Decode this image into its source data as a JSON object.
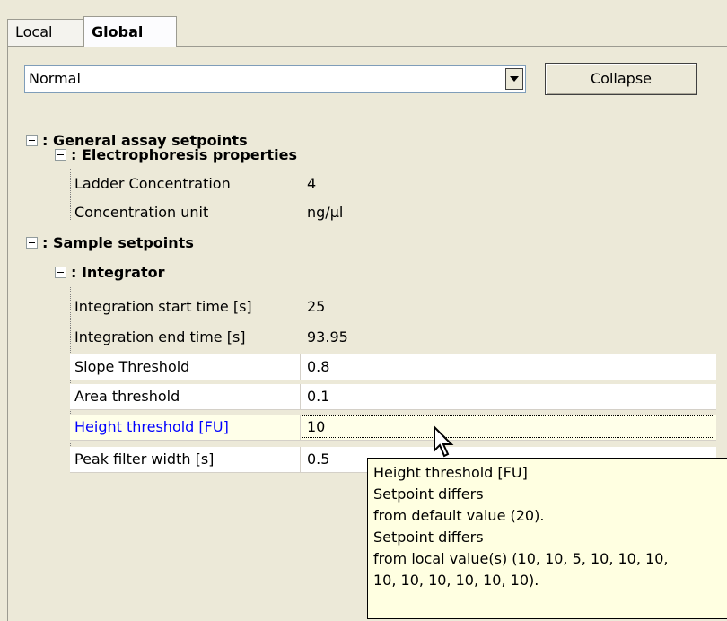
{
  "tabs": [
    {
      "label": "Local"
    },
    {
      "label": "Global"
    }
  ],
  "view_select": {
    "value": "Normal"
  },
  "collapse_button": {
    "label": "Collapse"
  },
  "tree": {
    "general": {
      "label": ": General assay setpoints",
      "electrophoresis": {
        "label": ": Electrophoresis properties",
        "rows": [
          {
            "name": "Ladder Concentration",
            "value": "4"
          },
          {
            "name": "Concentration unit",
            "value": "ng/µl"
          }
        ]
      }
    },
    "sample": {
      "label": ": Sample setpoints",
      "integrator": {
        "label": ": Integrator",
        "rows": [
          {
            "name": "Integration start time [s]",
            "value": "25"
          },
          {
            "name": "Integration end time [s]",
            "value": "93.95"
          },
          {
            "name": "Slope Threshold",
            "value": "0.8"
          },
          {
            "name": "Area threshold",
            "value": "0.1"
          },
          {
            "name": "Height threshold [FU]",
            "value": "10"
          },
          {
            "name": "Peak filter width [s]",
            "value": "0.5"
          }
        ]
      }
    }
  },
  "tooltip": {
    "lines": [
      "Height threshold [FU]",
      "Setpoint differs",
      "from default value (20).",
      "Setpoint differs",
      "from local value(s) (10, 10, 5, 10, 10, 10,",
      "10, 10, 10, 10, 10, 10)."
    ]
  },
  "colors": {
    "background": "#ece9d8",
    "selected_label": "#0000ff",
    "tooltip_bg": "#ffffe1"
  }
}
